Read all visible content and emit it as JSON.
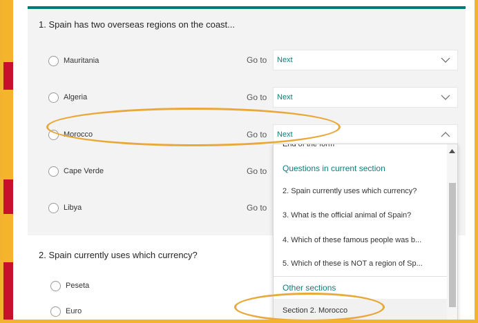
{
  "question1": {
    "title": "1. Spain has two overseas regions on the coast...",
    "options": [
      {
        "label": "Mauritania",
        "goto": "Go to",
        "value": "Next"
      },
      {
        "label": "Algeria",
        "goto": "Go to",
        "value": "Next"
      },
      {
        "label": "Morocco",
        "goto": "Go to",
        "value": "Next"
      },
      {
        "label": "Cape Verde",
        "goto": "Go to"
      },
      {
        "label": "Libya",
        "goto": "Go to"
      }
    ]
  },
  "dropdown": {
    "partial_top": "End of the form",
    "current_section_header": "Questions in current section",
    "items": [
      "2. Spain currently uses which currency?",
      "3. What is the official animal of Spain?",
      "4. Which of these famous people was b...",
      "5. Which of these is NOT a region of Sp..."
    ],
    "other_sections_header": "Other sections",
    "selected_item": "Section 2. Morocco"
  },
  "question2": {
    "title": "2. Spain currently uses which currency?",
    "options": [
      {
        "label": "Peseta"
      },
      {
        "label": "Euro"
      }
    ]
  },
  "colors": {
    "accent": "#007a78",
    "highlight": "#e8a83a",
    "border": "#f3b32f"
  }
}
